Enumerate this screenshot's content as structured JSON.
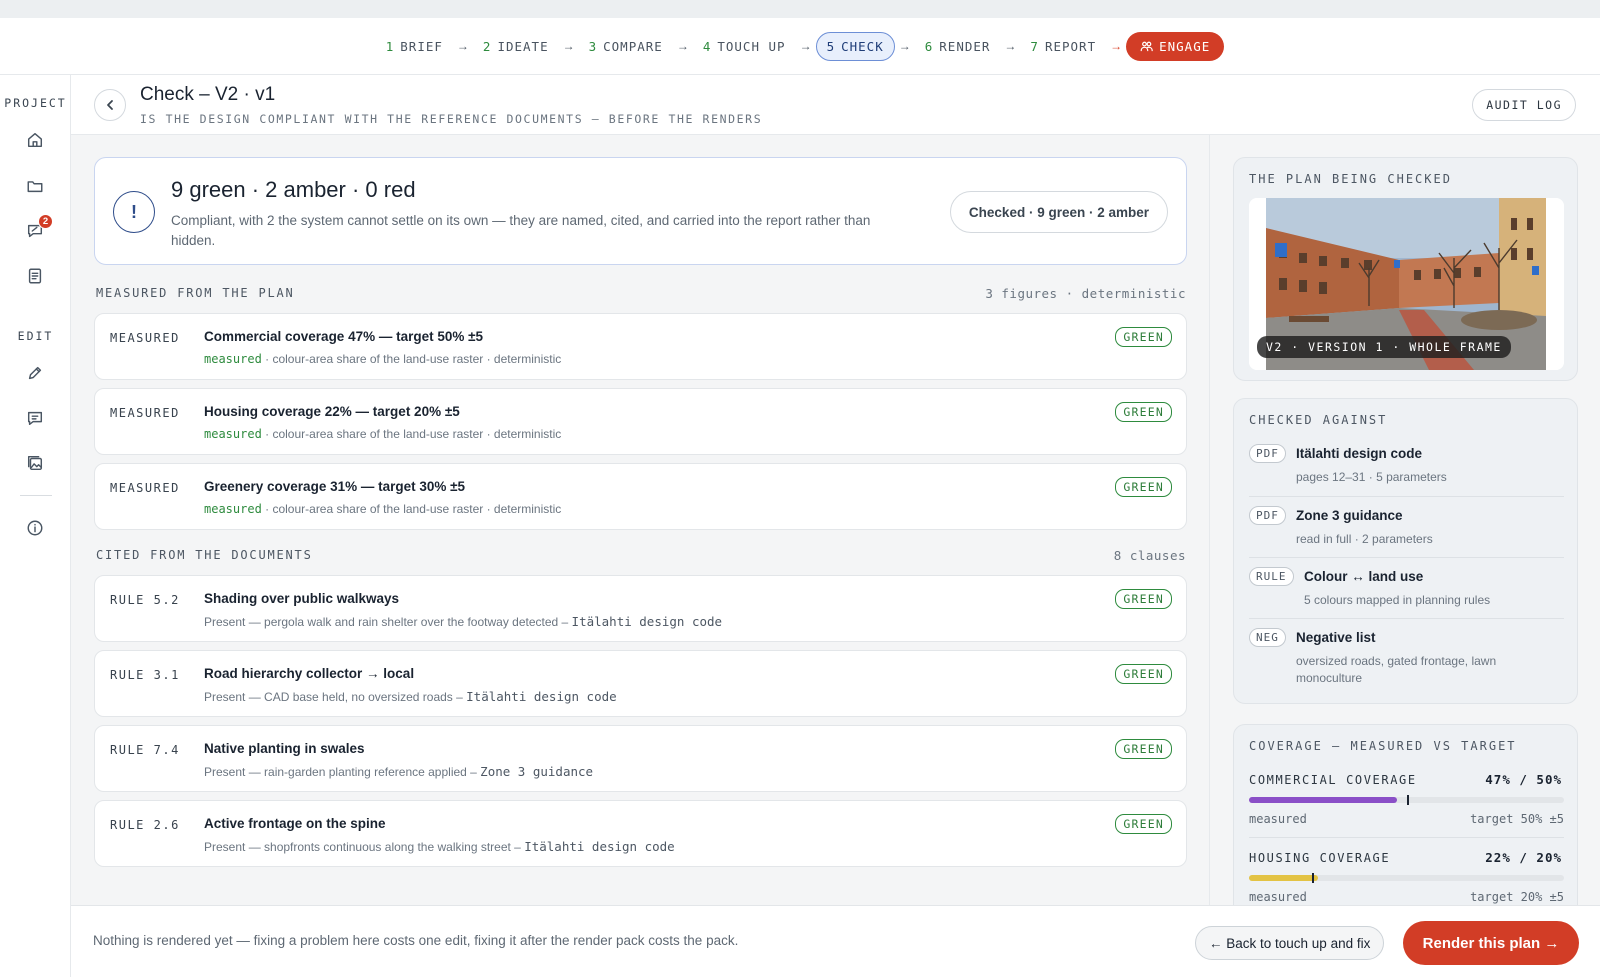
{
  "steps": [
    {
      "num": "1",
      "label": "BRIEF"
    },
    {
      "num": "2",
      "label": "IDEATE"
    },
    {
      "num": "3",
      "label": "COMPARE"
    },
    {
      "num": "4",
      "label": "TOUCH UP"
    },
    {
      "num": "5",
      "label": "CHECK"
    },
    {
      "num": "6",
      "label": "RENDER"
    },
    {
      "num": "7",
      "label": "REPORT"
    }
  ],
  "step_arrow": "→",
  "engage_label": "ENGAGE",
  "sidebar": {
    "project_label": "PROJECT",
    "edit_label": "EDIT",
    "notification_count": "2"
  },
  "header": {
    "title": "Check – V2 · v1",
    "subtitle": "IS THE DESIGN COMPLIANT WITH THE REFERENCE DOCUMENTS — BEFORE THE RENDERS",
    "audit_label": "AUDIT LOG"
  },
  "summary": {
    "icon": "!",
    "title": "9 green · 2 amber · 0 red",
    "text": "Compliant, with 2 the system cannot settle on its own — they are named, cited, and carried into the report rather than hidden.",
    "pill": "Checked · 9 green · 2 amber"
  },
  "measured": {
    "heading": "MEASURED FROM THE PLAN",
    "meta": "3 figures · deterministic",
    "rows": [
      {
        "tag": "MEASURED",
        "title": "Commercial coverage 47% — target 50% ±5",
        "method": "measured",
        "detail": " · colour-area share of the land-use raster · deterministic",
        "status": "GREEN"
      },
      {
        "tag": "MEASURED",
        "title": "Housing coverage 22% — target 20% ±5",
        "method": "measured",
        "detail": " · colour-area share of the land-use raster · deterministic",
        "status": "GREEN"
      },
      {
        "tag": "MEASURED",
        "title": "Greenery coverage 31% — target 30% ±5",
        "method": "measured",
        "detail": " · colour-area share of the land-use raster · deterministic",
        "status": "GREEN"
      }
    ]
  },
  "cited": {
    "heading": "CITED FROM THE DOCUMENTS",
    "meta": "8 clauses",
    "rows": [
      {
        "tag": "RULE 5.2",
        "title": "Shading over public walkways",
        "detail": "Present — pergola walk and rain shelter over the footway detected – ",
        "doc": "Itälahti design code",
        "status": "GREEN"
      },
      {
        "tag": "RULE 3.1",
        "title": "Road hierarchy collector → local",
        "detail": "Present — CAD base held, no oversized roads – ",
        "doc": "Itälahti design code",
        "status": "GREEN"
      },
      {
        "tag": "RULE 7.4",
        "title": "Native planting in swales",
        "detail": "Present — rain-garden planting reference applied – ",
        "doc": "Zone 3 guidance",
        "status": "GREEN"
      },
      {
        "tag": "RULE 2.6",
        "title": "Active frontage on the spine",
        "detail": "Present — shopfronts continuous along the walking street – ",
        "doc": "Itälahti design code",
        "status": "GREEN"
      }
    ]
  },
  "plan_card": {
    "title": "THE PLAN BEING CHECKED",
    "caption": "V2 · VERSION 1 · WHOLE FRAME"
  },
  "checked_against": {
    "title": "CHECKED AGAINST",
    "items": [
      {
        "tag": "PDF",
        "name": "Itälahti design code",
        "desc": "pages 12–31 · 5 parameters"
      },
      {
        "tag": "PDF",
        "name": "Zone 3 guidance",
        "desc": "read in full · 2 parameters"
      },
      {
        "tag": "RULE",
        "name": "Colour ↔ land use",
        "desc": "5 colours mapped in planning rules"
      },
      {
        "tag": "NEG",
        "name": "Negative list",
        "desc": "oversized roads, gated frontage, lawn monoculture"
      }
    ]
  },
  "coverage": {
    "title": "COVERAGE — MEASURED VS TARGET",
    "items": [
      {
        "label": "COMMERCIAL COVERAGE",
        "value": "47% / 50%",
        "measured_pct": 47,
        "target_pct": 50,
        "color": "#8a4fc7",
        "left_note": "measured",
        "right_note": "target 50% ±5"
      },
      {
        "label": "HOUSING COVERAGE",
        "value": "22% / 20%",
        "measured_pct": 22,
        "target_pct": 20,
        "color": "#e3c344",
        "left_note": "measured",
        "right_note": "target 20% ±5"
      }
    ]
  },
  "footer": {
    "text": "Nothing is rendered yet — fixing a problem here costs one edit, fixing it after the render pack costs the pack.",
    "back_label": "← Back to touch up and fix",
    "render_label": "Render this plan →"
  }
}
